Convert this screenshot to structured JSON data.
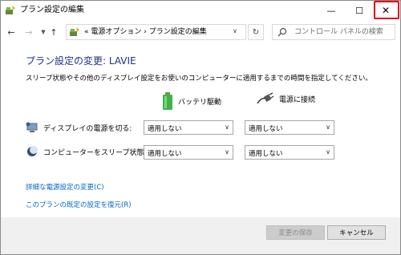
{
  "window": {
    "title": "プラン設定の編集",
    "minimize_glyph": "—",
    "maximize_glyph": "☐",
    "close_glyph": "✕",
    "highlight_color": "#e0001a"
  },
  "navbar": {
    "back_glyph": "←",
    "forward_glyph": "→",
    "history_glyph": "▼",
    "up_glyph": "↑",
    "address": "« 電源オプション › プラン設定の編集",
    "address_dropdown_glyph": "∨",
    "refresh_glyph": "↻",
    "search_placeholder": "コントロール パネルの検索"
  },
  "main": {
    "heading": "プラン設定の変更: LAVIE",
    "description": "スリープ状態やその他のディスプレイ設定をお使いのコンピューターに適用するまでの時間を指定してください。",
    "columns": {
      "battery": "バッテリ駆動",
      "ac": "電源に接続"
    },
    "rows": [
      {
        "label": "ディスプレイの電源を切る:",
        "battery_value": "適用しない",
        "ac_value": "適用しない"
      },
      {
        "label": "コンピューターをスリープ状態にする:",
        "battery_value": "適用しない",
        "ac_value": "適用しない"
      }
    ],
    "links": {
      "advanced": "詳細な電源設定の変更(C)",
      "restore": "このプランの既定の設定を復元(R)"
    }
  },
  "footer": {
    "save_label": "変更の保存",
    "cancel_label": "キャンセル"
  },
  "colors": {
    "heading": "#1e3287",
    "link": "#0066cc",
    "footer_bg": "#f0f0f0"
  },
  "icons": {
    "app": "power-options-icon",
    "battery": "battery-icon",
    "ac": "power-plug-icon",
    "display": "display-icon",
    "sleep": "sleep-moon-icon",
    "search": "search-icon"
  }
}
